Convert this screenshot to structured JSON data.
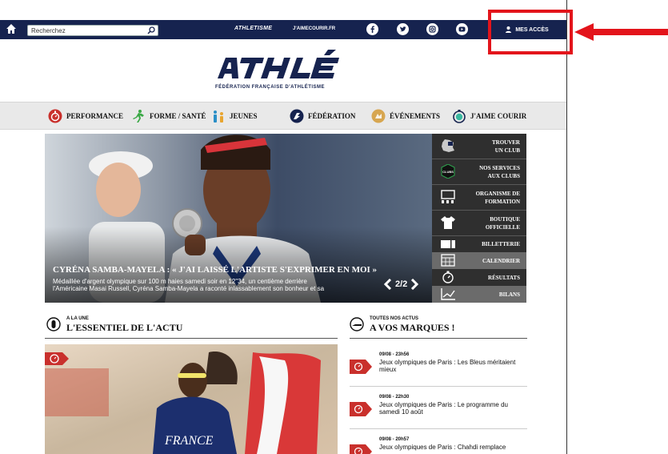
{
  "topbar": {
    "search_placeholder": "Recherchez",
    "brand_athletisme": "ATHLETISME",
    "brand_jaimecourir": "J'AIMECOURIR.FR",
    "mes_acces": "MES ACCÈS",
    "background": "#16234f"
  },
  "logo": {
    "text": "ATHLÉ",
    "subtitle": "FÉDÉRATION FRANÇAISE D'ATHLÉTISME",
    "color": "#16234f"
  },
  "nav": {
    "items": [
      {
        "label": "PERFORMANCE",
        "icon": "stopwatch-icon"
      },
      {
        "label": "FORME / SANTÉ",
        "icon": "runner-icon"
      },
      {
        "label": "JEUNES",
        "icon": "kids-icon"
      },
      {
        "label": "FÉDÉRATION",
        "icon": "federation-icon"
      },
      {
        "label": "ÉVÉNEMENTS",
        "icon": "events-icon"
      },
      {
        "label": "J'AIME COURIR",
        "icon": "jaimecourir-icon"
      }
    ]
  },
  "hero": {
    "title": "CYRÉNA SAMBA-MAYELA : « J'AI LAISSÉ L'ARTISTE S'EXPRIMER EN MOI »",
    "description": "Médaillée d'argent olympique sur 100 m haies samedi soir en 12\"34, un centième derrière l'Américaine Masai Russell, Cyréna Samba-Mayela a raconté inlassablement son bonheur et sa",
    "pager": "2/2"
  },
  "side_menu": {
    "items": [
      {
        "label_line1": "TROUVER",
        "label_line2": "UN CLUB",
        "icon": "france-map-icon"
      },
      {
        "label_line1": "NOS SERVICES",
        "label_line2": "AUX CLUBS",
        "icon": "services-badge-icon"
      },
      {
        "label_line1": "ORGANISME DE",
        "label_line2": "FORMATION",
        "icon": "training-icon"
      },
      {
        "label_line1": "BOUTIQUE",
        "label_line2": "OFFICIELLE",
        "icon": "shirt-icon"
      },
      {
        "label_line1": "BILLETTERIE",
        "label_line2": "",
        "icon": "ticket-icon"
      },
      {
        "label_line1": "CALENDRIER",
        "label_line2": "",
        "icon": "calendar-icon"
      },
      {
        "label_line1": "RÉSULTATS",
        "label_line2": "",
        "icon": "stopwatch-icon"
      },
      {
        "label_line1": "BILANS",
        "label_line2": "",
        "icon": "chart-icon"
      }
    ]
  },
  "essentiel": {
    "pre": "A LA UNE",
    "title": "L'ESSENTIEL DE L'ACTU"
  },
  "marques": {
    "pre": "TOUTES NOS ACTUS",
    "title": "A VOS MARQUES !",
    "news": [
      {
        "time": "09/08 - 23h56",
        "text": "Jeux olympiques de Paris : Les Bleus méritaient mieux"
      },
      {
        "time": "09/08 - 22h30",
        "text": "Jeux olympiques de Paris : Le programme du samedi 10 août"
      },
      {
        "time": "09/08 - 20h57",
        "text": "Jeux olympiques de Paris : Chahdi remplace"
      }
    ]
  },
  "colors": {
    "accent_red": "#c9302c",
    "navy": "#16234f",
    "annotation_red": "#e3141b"
  }
}
